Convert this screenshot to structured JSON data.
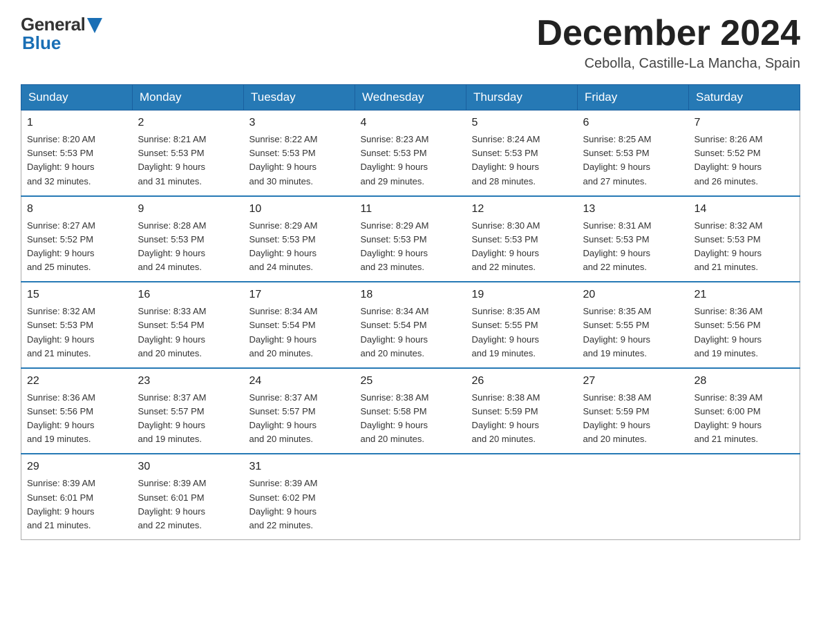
{
  "header": {
    "logo_general": "General",
    "logo_blue": "Blue",
    "month_year": "December 2024",
    "location": "Cebolla, Castille-La Mancha, Spain"
  },
  "days_of_week": [
    "Sunday",
    "Monday",
    "Tuesday",
    "Wednesday",
    "Thursday",
    "Friday",
    "Saturday"
  ],
  "weeks": [
    [
      {
        "day": "1",
        "sunrise": "8:20 AM",
        "sunset": "5:53 PM",
        "daylight": "9 hours and 32 minutes."
      },
      {
        "day": "2",
        "sunrise": "8:21 AM",
        "sunset": "5:53 PM",
        "daylight": "9 hours and 31 minutes."
      },
      {
        "day": "3",
        "sunrise": "8:22 AM",
        "sunset": "5:53 PM",
        "daylight": "9 hours and 30 minutes."
      },
      {
        "day": "4",
        "sunrise": "8:23 AM",
        "sunset": "5:53 PM",
        "daylight": "9 hours and 29 minutes."
      },
      {
        "day": "5",
        "sunrise": "8:24 AM",
        "sunset": "5:53 PM",
        "daylight": "9 hours and 28 minutes."
      },
      {
        "day": "6",
        "sunrise": "8:25 AM",
        "sunset": "5:53 PM",
        "daylight": "9 hours and 27 minutes."
      },
      {
        "day": "7",
        "sunrise": "8:26 AM",
        "sunset": "5:52 PM",
        "daylight": "9 hours and 26 minutes."
      }
    ],
    [
      {
        "day": "8",
        "sunrise": "8:27 AM",
        "sunset": "5:52 PM",
        "daylight": "9 hours and 25 minutes."
      },
      {
        "day": "9",
        "sunrise": "8:28 AM",
        "sunset": "5:53 PM",
        "daylight": "9 hours and 24 minutes."
      },
      {
        "day": "10",
        "sunrise": "8:29 AM",
        "sunset": "5:53 PM",
        "daylight": "9 hours and 24 minutes."
      },
      {
        "day": "11",
        "sunrise": "8:29 AM",
        "sunset": "5:53 PM",
        "daylight": "9 hours and 23 minutes."
      },
      {
        "day": "12",
        "sunrise": "8:30 AM",
        "sunset": "5:53 PM",
        "daylight": "9 hours and 22 minutes."
      },
      {
        "day": "13",
        "sunrise": "8:31 AM",
        "sunset": "5:53 PM",
        "daylight": "9 hours and 22 minutes."
      },
      {
        "day": "14",
        "sunrise": "8:32 AM",
        "sunset": "5:53 PM",
        "daylight": "9 hours and 21 minutes."
      }
    ],
    [
      {
        "day": "15",
        "sunrise": "8:32 AM",
        "sunset": "5:53 PM",
        "daylight": "9 hours and 21 minutes."
      },
      {
        "day": "16",
        "sunrise": "8:33 AM",
        "sunset": "5:54 PM",
        "daylight": "9 hours and 20 minutes."
      },
      {
        "day": "17",
        "sunrise": "8:34 AM",
        "sunset": "5:54 PM",
        "daylight": "9 hours and 20 minutes."
      },
      {
        "day": "18",
        "sunrise": "8:34 AM",
        "sunset": "5:54 PM",
        "daylight": "9 hours and 20 minutes."
      },
      {
        "day": "19",
        "sunrise": "8:35 AM",
        "sunset": "5:55 PM",
        "daylight": "9 hours and 19 minutes."
      },
      {
        "day": "20",
        "sunrise": "8:35 AM",
        "sunset": "5:55 PM",
        "daylight": "9 hours and 19 minutes."
      },
      {
        "day": "21",
        "sunrise": "8:36 AM",
        "sunset": "5:56 PM",
        "daylight": "9 hours and 19 minutes."
      }
    ],
    [
      {
        "day": "22",
        "sunrise": "8:36 AM",
        "sunset": "5:56 PM",
        "daylight": "9 hours and 19 minutes."
      },
      {
        "day": "23",
        "sunrise": "8:37 AM",
        "sunset": "5:57 PM",
        "daylight": "9 hours and 19 minutes."
      },
      {
        "day": "24",
        "sunrise": "8:37 AM",
        "sunset": "5:57 PM",
        "daylight": "9 hours and 20 minutes."
      },
      {
        "day": "25",
        "sunrise": "8:38 AM",
        "sunset": "5:58 PM",
        "daylight": "9 hours and 20 minutes."
      },
      {
        "day": "26",
        "sunrise": "8:38 AM",
        "sunset": "5:59 PM",
        "daylight": "9 hours and 20 minutes."
      },
      {
        "day": "27",
        "sunrise": "8:38 AM",
        "sunset": "5:59 PM",
        "daylight": "9 hours and 20 minutes."
      },
      {
        "day": "28",
        "sunrise": "8:39 AM",
        "sunset": "6:00 PM",
        "daylight": "9 hours and 21 minutes."
      }
    ],
    [
      {
        "day": "29",
        "sunrise": "8:39 AM",
        "sunset": "6:01 PM",
        "daylight": "9 hours and 21 minutes."
      },
      {
        "day": "30",
        "sunrise": "8:39 AM",
        "sunset": "6:01 PM",
        "daylight": "9 hours and 22 minutes."
      },
      {
        "day": "31",
        "sunrise": "8:39 AM",
        "sunset": "6:02 PM",
        "daylight": "9 hours and 22 minutes."
      },
      null,
      null,
      null,
      null
    ]
  ],
  "labels": {
    "sunrise": "Sunrise:",
    "sunset": "Sunset:",
    "daylight": "Daylight:"
  }
}
